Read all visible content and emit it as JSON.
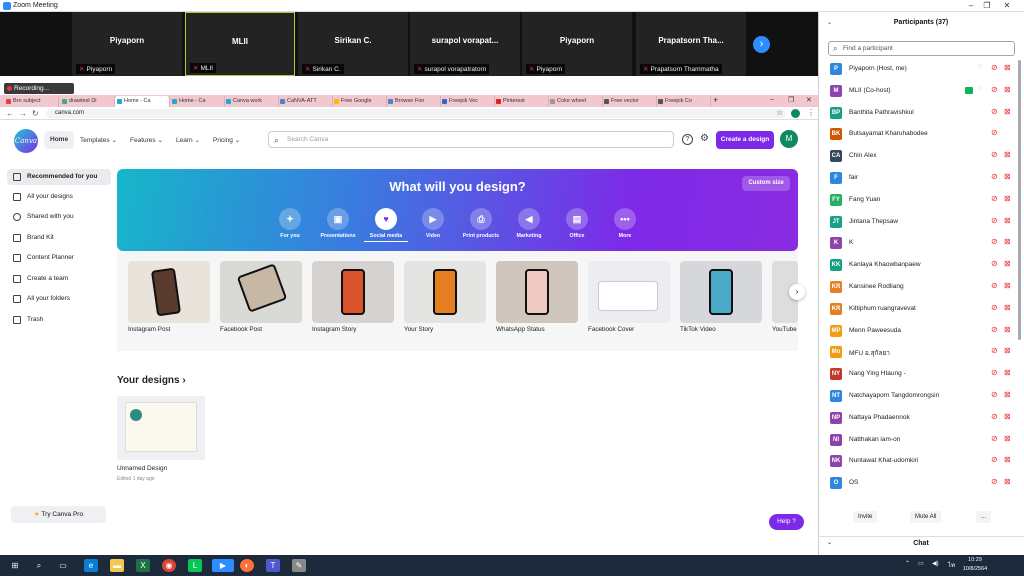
{
  "window": {
    "title": "Zoom Meeting"
  },
  "gallery": {
    "tiles": [
      {
        "big": "Piyaporn",
        "small": "Piyaporn"
      },
      {
        "big": "MLII",
        "small": "MLII"
      },
      {
        "big": "Sirikan C.",
        "small": "Sirikan C."
      },
      {
        "big": "surapol  vorapat...",
        "small": "surapol vorapatratorn"
      },
      {
        "big": "Piyaporn",
        "small": "Piyaporn"
      },
      {
        "big": "Prapatsorn  Tha...",
        "small": "Prapatsorn Thammatha"
      }
    ]
  },
  "recording": "Recording...",
  "browser": {
    "tabs": [
      "Bro subject",
      "drawtext Di",
      "Home - Ca",
      "Home - Ca",
      "Canva work",
      "CaNVA-ATT",
      "Free Google",
      "Browse Fon",
      "Freepik Vec",
      "Pinterest",
      "Color wheel",
      "Free vector",
      "Freepik Co"
    ],
    "url": "canva.com"
  },
  "canva": {
    "logo": "Canva",
    "nav": [
      "Home",
      "Templates",
      "Features",
      "Learn",
      "Pricing"
    ],
    "search_placeholder": "Search Canva",
    "create": "Create a design",
    "avatar": "M",
    "sidebar": [
      "Recommended for you",
      "All your designs",
      "Shared with you",
      "Brand Kit",
      "Content Planner",
      "Create a team",
      "All your folders",
      "Trash"
    ],
    "pro": "Try Canva Pro",
    "hero": "What will you design?",
    "custom": "Custom size",
    "categories": [
      "For you",
      "Presentations",
      "Social media",
      "Video",
      "Print products",
      "Marketing",
      "Office",
      "More"
    ],
    "cards": [
      "Instagram Post",
      "Facebook Post",
      "Instagram Story",
      "Your Story",
      "WhatsApp Status",
      "Facebook Cover",
      "TikTok Video",
      "YouTube"
    ],
    "your_designs": "Your designs ›",
    "design": {
      "name": "Unnamed Design",
      "date": "Edited 1 day ago"
    },
    "help": "Help ?"
  },
  "participants": {
    "title": "Participants (37)",
    "search_placeholder": "Find a participant",
    "list": [
      {
        "initials": "P",
        "name": "Piyaporn (Host, me)",
        "color": "#2e86de"
      },
      {
        "initials": "M",
        "name": "MLII (Co-host)",
        "color": "#8e44ad"
      },
      {
        "initials": "BP",
        "name": "Banthita Pathravishkul",
        "color": "#16a085"
      },
      {
        "initials": "BK",
        "name": "Butsayamat Kharuhabodee",
        "color": "#d35400"
      },
      {
        "initials": "CA",
        "name": "Chin Alex",
        "color": "#34495e"
      },
      {
        "initials": "F",
        "name": "fair",
        "color": "#2e86de"
      },
      {
        "initials": "FY",
        "name": "Fang Yuan",
        "color": "#27ae60"
      },
      {
        "initials": "JT",
        "name": "Jintana Thepsaw",
        "color": "#16a085"
      },
      {
        "initials": "K",
        "name": "K",
        "color": "#8e44ad"
      },
      {
        "initials": "KK",
        "name": "Kanlaya Khaowbanpaew",
        "color": "#16a085"
      },
      {
        "initials": "KR",
        "name": "Kansinee Rodliang",
        "color": "#e67e22"
      },
      {
        "initials": "KR",
        "name": "Kittiphum ruangravevat",
        "color": "#e67e22"
      },
      {
        "initials": "MP",
        "name": "Menn Paweesuda",
        "color": "#f39c12"
      },
      {
        "initials": "Mo",
        "name": "MFU อ.สุกัลยา",
        "color": "#f39c12"
      },
      {
        "initials": "NY",
        "name": "Nang Ying Htaung -",
        "color": "#c0392b"
      },
      {
        "initials": "NT",
        "name": "Natchayaporn Tangdomrongsin",
        "color": "#2e86de"
      },
      {
        "initials": "NP",
        "name": "Nattaya Phadaennok",
        "color": "#8e44ad"
      },
      {
        "initials": "NI",
        "name": "Natthakan iam-on",
        "color": "#8e44ad"
      },
      {
        "initials": "NK",
        "name": "Nuntawat Khat-udomkiri",
        "color": "#8e44ad"
      },
      {
        "initials": "O",
        "name": "OS",
        "color": "#2e86de"
      }
    ],
    "invite": "Invite",
    "muteall": "Mute All",
    "more": "...",
    "chat": "Chat"
  },
  "taskbar": {
    "time": "10:29",
    "date": "10/8/2564"
  }
}
